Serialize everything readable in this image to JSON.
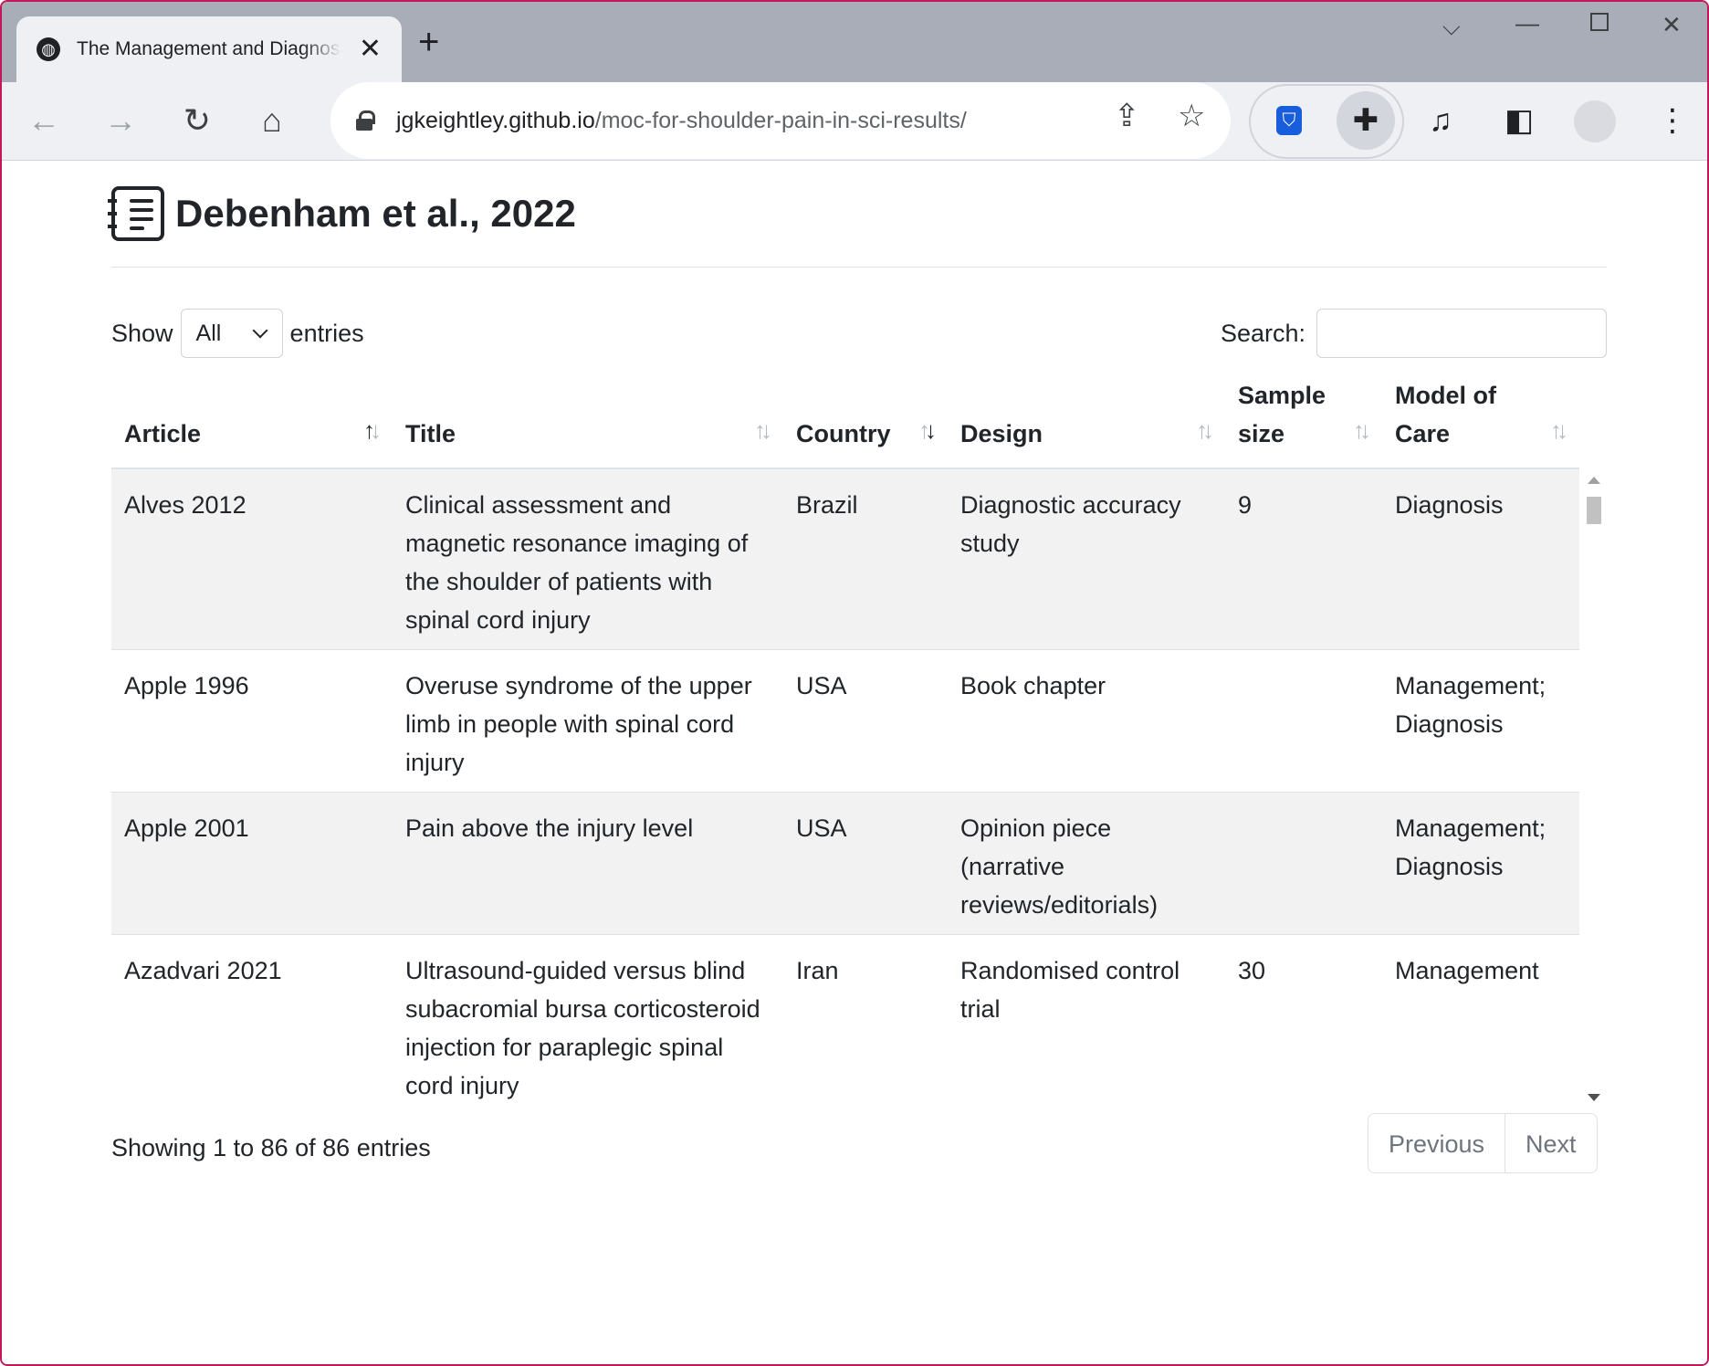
{
  "browser": {
    "tab_title": "The Management and Diagnosis",
    "url_host": "jgkeightley.github.io",
    "url_path": "/moc-for-shoulder-pain-in-sci-results/"
  },
  "page": {
    "heading": "Debenham et al., 2022",
    "show_label": "Show",
    "show_value": "All",
    "entries_label": "entries",
    "search_label": "Search:",
    "search_value": "",
    "info": "Showing 1 to 86 of 86 entries",
    "prev_label": "Previous",
    "next_label": "Next"
  },
  "table": {
    "columns": [
      {
        "label": "Article",
        "sort": "asc"
      },
      {
        "label": "Title",
        "sort": "none"
      },
      {
        "label": "Country",
        "sort": "desc"
      },
      {
        "label": "Design",
        "sort": "none"
      },
      {
        "label": "Sample size",
        "sort": "none"
      },
      {
        "label": "Model of Care",
        "sort": "none"
      }
    ],
    "rows": [
      [
        "Alves 2012",
        "Clinical assessment and magnetic resonance imaging of the shoulder of patients with spinal cord injury",
        "Brazil",
        "Diagnostic accuracy study",
        "9",
        "Diagnosis"
      ],
      [
        "Apple 1996",
        "Overuse syndrome of the upper limb in people with spinal cord injury",
        "USA",
        "Book chapter",
        "",
        "Management; Diagnosis"
      ],
      [
        "Apple 2001",
        "Pain above the injury level",
        "USA",
        "Opinion piece (narrative reviews/editorials)",
        "",
        "Management; Diagnosis"
      ],
      [
        "Azadvari 2021",
        "Ultrasound-guided versus blind subacromial bursa corticosteroid injection for paraplegic spinal cord injury",
        "Iran",
        "Randomised control trial",
        "30",
        "Management"
      ]
    ]
  }
}
